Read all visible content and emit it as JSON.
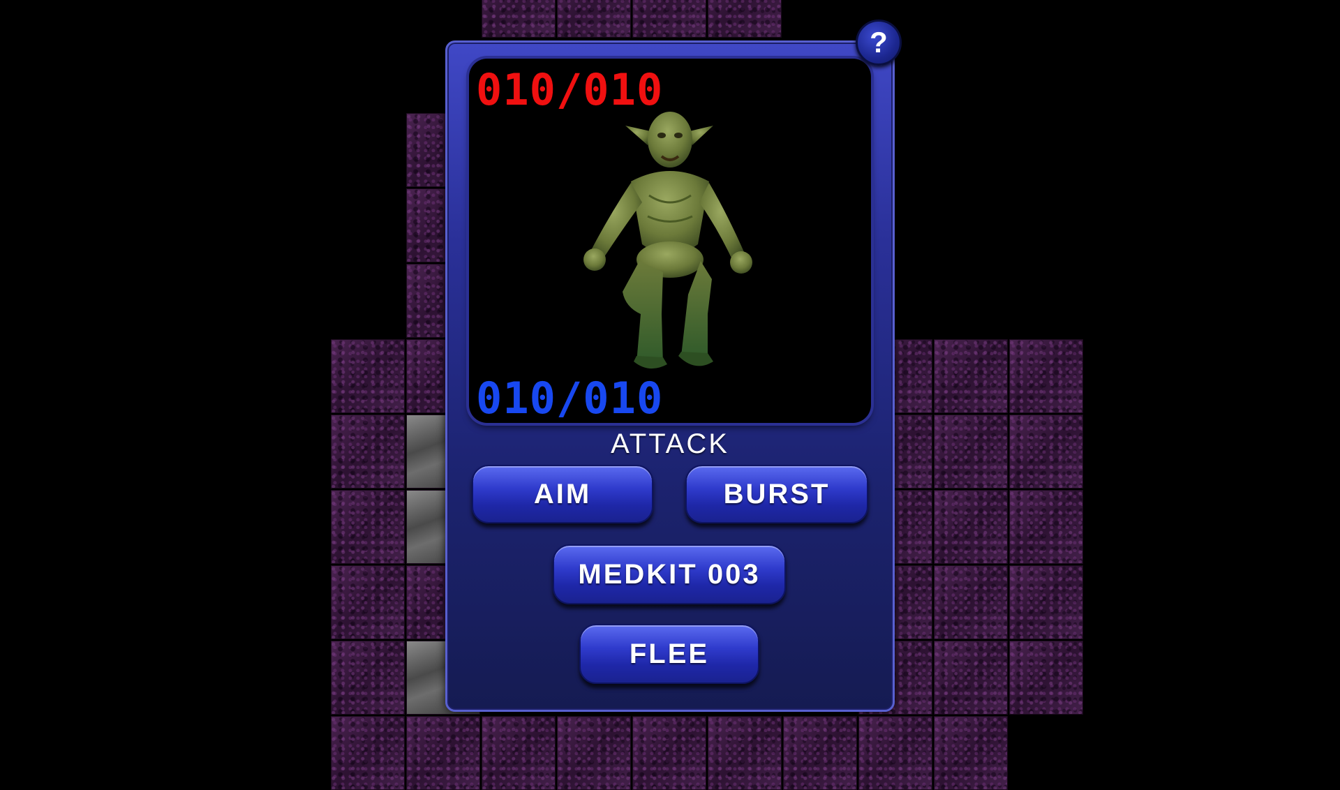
{
  "enemy_hp": "010/010",
  "player_hp": "010/010",
  "enemy": {
    "name": "goblin"
  },
  "menu": {
    "title": "ATTACK",
    "aim_label": "AIM",
    "burst_label": "BURST",
    "medkit_label": "MEDKIT 003",
    "flee_label": "FLEE"
  },
  "help_label": "?",
  "colors": {
    "enemy_hp": "#f01010",
    "player_hp": "#1848f0",
    "panel": "#2a3098",
    "floor_tile": "#3c1a40"
  }
}
